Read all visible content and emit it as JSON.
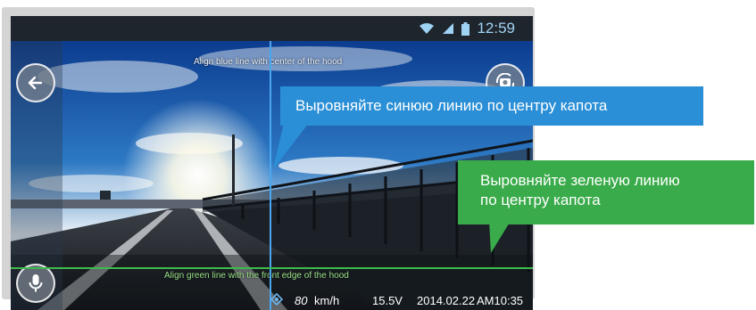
{
  "status_bar": {
    "time": "12:59",
    "icons": [
      "wifi-icon",
      "signal-icon",
      "battery-icon"
    ]
  },
  "camera_view": {
    "blue_guide_text": "Align blue line with center of the hood",
    "green_guide_text": "Align green line with the front edge of the hood",
    "buttons": [
      "back-arrow-icon",
      "rotate-camera-icon",
      "microphone-icon"
    ]
  },
  "info_bar": {
    "speed_value": "80",
    "speed_unit": "km/h",
    "voltage": "15.5V",
    "date": "2014.02.22",
    "time": "AM10:35",
    "icon": "gps-icon"
  },
  "callouts": {
    "blue": "Выровняйте синюю линию по центру капота",
    "green_line1": "Выровняйте зеленую линию",
    "green_line2": "по центру капота"
  },
  "colors": {
    "blue_accent": "#2a8fd6",
    "green_accent": "#3aab4a",
    "status_icon": "#9fd3f3"
  }
}
